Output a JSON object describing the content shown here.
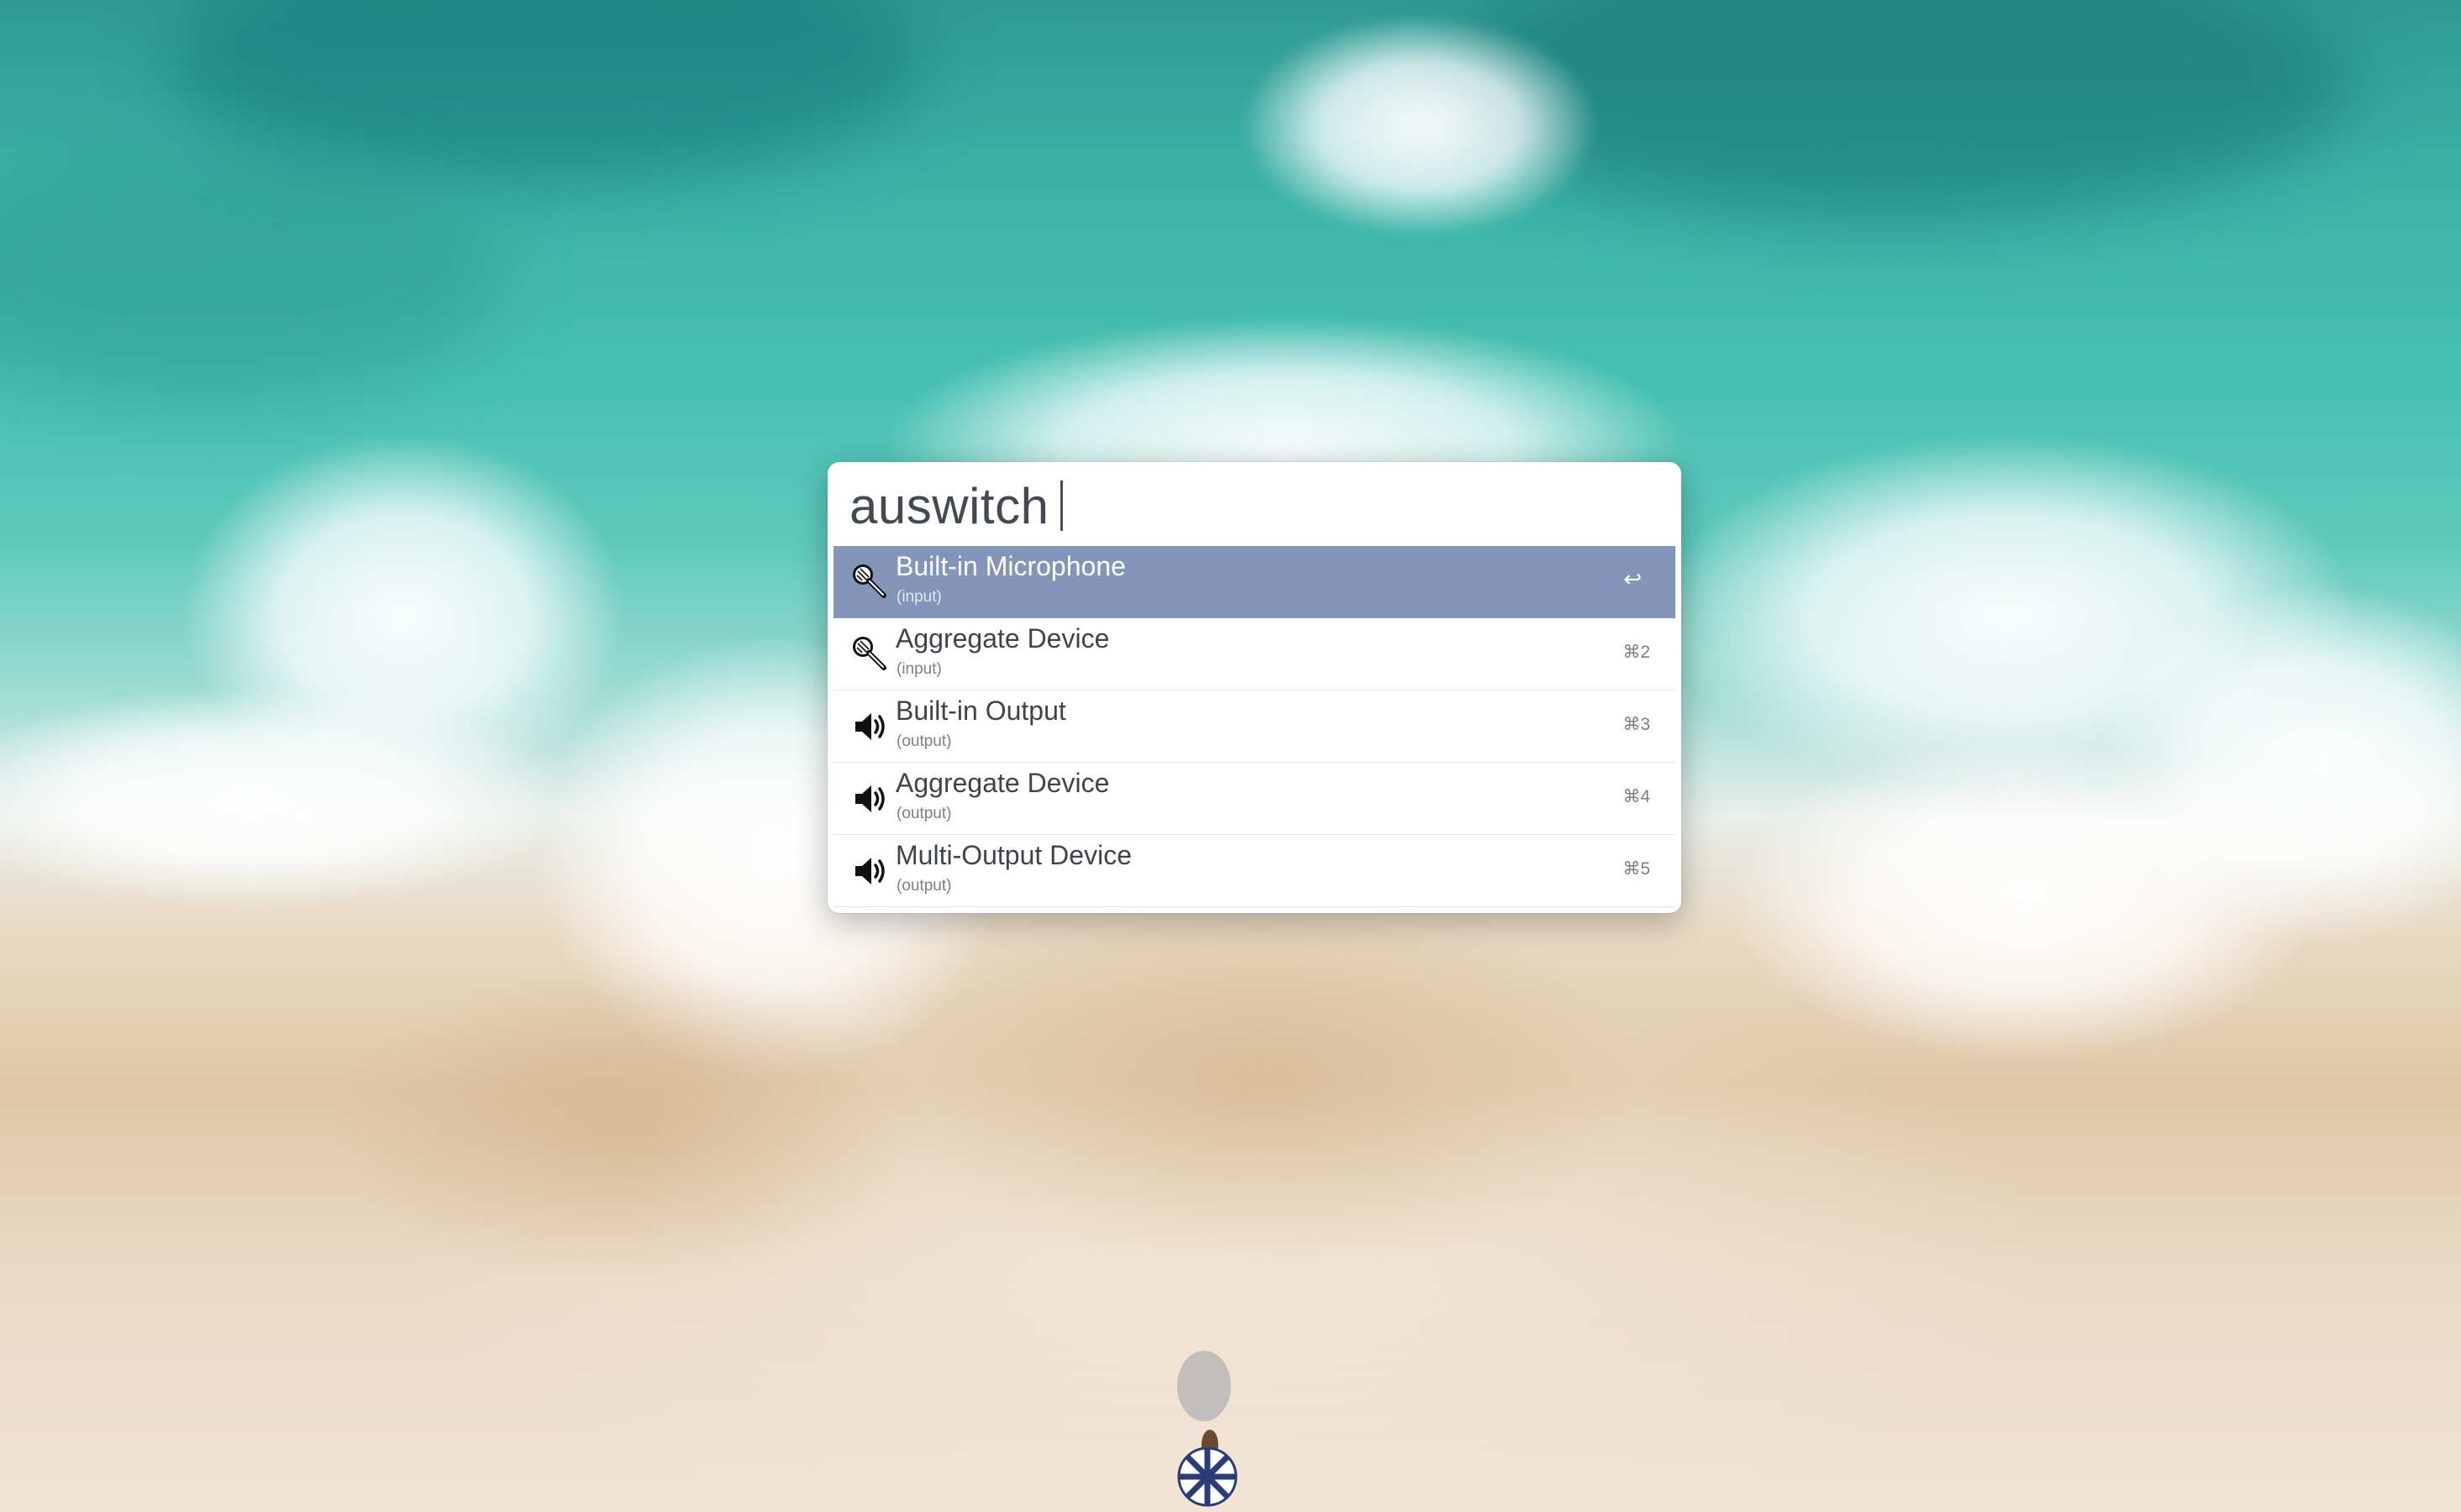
{
  "query": {
    "value": "auswitch"
  },
  "results": [
    {
      "title": "Built-in Microphone",
      "subtitle": "(input)",
      "shortcut": "↩",
      "icon": "microphone-icon",
      "selected": true
    },
    {
      "title": "Aggregate Device",
      "subtitle": "(input)",
      "shortcut": "⌘2",
      "icon": "microphone-icon",
      "selected": false
    },
    {
      "title": "Built-in Output",
      "subtitle": "(output)",
      "shortcut": "⌘3",
      "icon": "speaker-icon",
      "selected": false
    },
    {
      "title": "Aggregate Device",
      "subtitle": "(output)",
      "shortcut": "⌘4",
      "icon": "speaker-icon",
      "selected": false
    },
    {
      "title": "Multi-Output Device",
      "subtitle": "(output)",
      "shortcut": "⌘5",
      "icon": "speaker-icon",
      "selected": false
    }
  ],
  "colors": {
    "selection": "#8495ba",
    "window_background": "#ffffff",
    "text": "#3f444b"
  }
}
